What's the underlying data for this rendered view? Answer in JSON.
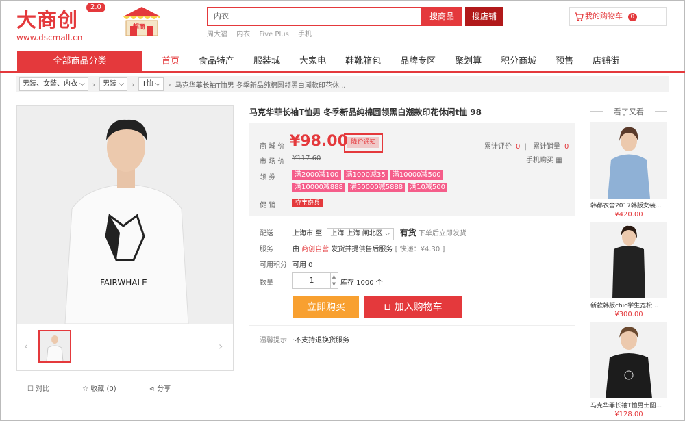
{
  "header": {
    "logo_text": "大商创",
    "logo_url": "www.dscmall.cn",
    "version": "2.0",
    "promo_label": "超商",
    "search_value": "内衣",
    "search_goods_label": "搜商品",
    "search_shop_label": "搜店铺",
    "hot_words": [
      "周大福",
      "内衣",
      "Five Plus",
      "手机"
    ],
    "cart_label": "我的购物车",
    "cart_count": "0"
  },
  "nav": {
    "all_categories": "全部商品分类",
    "items": [
      "首页",
      "食品特产",
      "服装城",
      "大家电",
      "鞋靴箱包",
      "品牌专区",
      "聚划算",
      "积分商城",
      "预售",
      "店铺街"
    ]
  },
  "breadcrumb": {
    "level1": "男装、女装、内衣",
    "level2": "男装",
    "level3": "T恤",
    "current": "马克华菲长袖T恤男 冬季新品纯棉圆领黑白潮款印花休..."
  },
  "gallery": {
    "shirt_print": "FAIRWHALE",
    "tools": [
      "对比",
      "收藏 (0)",
      "分享"
    ]
  },
  "product": {
    "title": "马克华菲长袖T恤男 冬季新品纯棉圆领黑白潮款印花休闲t恤 98",
    "price_label": "商 城 价",
    "price": "¥98.00",
    "price_notice": "降价通知",
    "market_price_label": "市 场 价",
    "market_price": "¥117.60",
    "coupon_label": "领 券",
    "coupons": [
      "满2000减100",
      "满1000减35",
      "满10000减500",
      "满10000减888",
      "满50000减5888",
      "满10减500"
    ],
    "promo_label": "促 销",
    "promo_tag": "夺宝奇兵",
    "review_label": "累计评价",
    "review_count": "0",
    "sales_label": "累计销量",
    "sales_count": "0",
    "mobile_buy": "手机购买",
    "delivery_label": "配送",
    "delivery_from": "上海市",
    "delivery_to_word": "至",
    "delivery_address": "上海 上海 闸北区",
    "in_stock": "有货",
    "in_stock_note": "下单后立即发货",
    "service_label": "服务",
    "service_prefix": "由",
    "service_shop": "商创自营",
    "service_text": "发货并提供售后服务",
    "service_fee": "[ 快递：¥4.30 ]",
    "points_label": "可用积分",
    "points_value": "可用 0",
    "quantity_label": "数量",
    "quantity": "1",
    "stock": "库存 1000 个",
    "buy_now": "立即购买",
    "add_to_cart": "加入购物车",
    "tip_label": "温馨提示",
    "tip_text": "·不支持退换货服务"
  },
  "side": {
    "title": "看了又看",
    "items": [
      {
        "name": "韩都衣舍2017韩版女装...",
        "price": "¥420.00"
      },
      {
        "name": "新款韩版chic学生宽松...",
        "price": "¥300.00"
      },
      {
        "name": "马克华菲长袖T恤男士圆...",
        "price": "¥128.00"
      }
    ]
  },
  "colors": {
    "brand": "#e4393c",
    "buy": "#f8a030",
    "coupon": "#f55d8a"
  }
}
